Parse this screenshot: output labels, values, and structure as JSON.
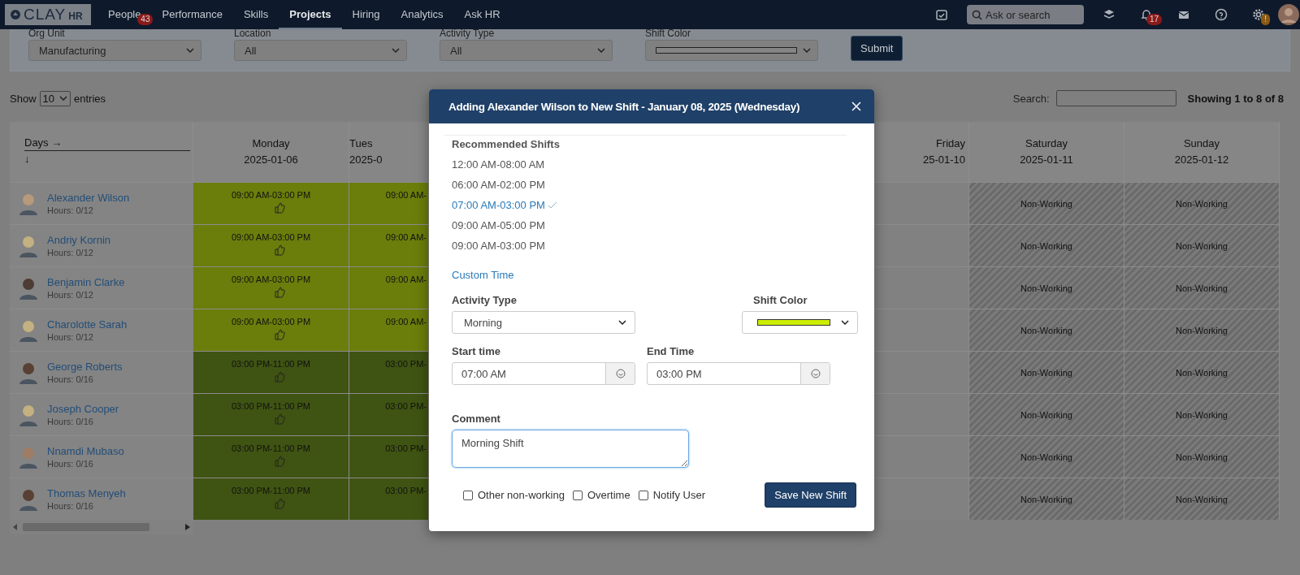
{
  "nav": {
    "logo": {
      "main": "CLAY",
      "sub": "HR"
    },
    "items": [
      {
        "label": "People",
        "selected": false,
        "badge": "43"
      },
      {
        "label": "Performance",
        "selected": false
      },
      {
        "label": "Skills",
        "selected": false
      },
      {
        "label": "Projects",
        "selected": true
      },
      {
        "label": "Hiring",
        "selected": false
      },
      {
        "label": "Analytics",
        "selected": false
      },
      {
        "label": "Ask HR",
        "selected": false
      }
    ],
    "search": {
      "placeholder": "Ask or search"
    },
    "notification_badge": "17",
    "settings_badge": "!"
  },
  "filters": [
    {
      "label": "Org Unit",
      "kind": "select",
      "value": "Manufacturing"
    },
    {
      "label": "Location",
      "kind": "select",
      "value": "All"
    },
    {
      "label": "Activity Type",
      "kind": "select",
      "value": "All"
    },
    {
      "label": "Shift Color",
      "kind": "color",
      "color": "#858585"
    }
  ],
  "submit": "Submit",
  "entries": {
    "show": "Show",
    "value": "10",
    "suffix": "entries"
  },
  "search": {
    "label": "Search:"
  },
  "info": "Showing 1 to 8 of 8",
  "table": {
    "corner": {
      "across": "Days →",
      "down": "↓"
    },
    "columns": [
      {
        "day": "Monday",
        "date": "2025-01-06"
      },
      {
        "day": "Tues",
        "date": "2025-0"
      },
      {
        "day": "Friday",
        "date": "25-01-10"
      },
      {
        "day": "Saturday",
        "date": "2025-01-11"
      },
      {
        "day": "Sunday",
        "date": "2025-01-12"
      }
    ],
    "rows": [
      {
        "name": "Alexander Wilson",
        "hours": "Hours: 0/12",
        "cells": [
          {
            "kind": "morning",
            "text": "09:00 AM-03:00 PM",
            "liked": true
          },
          {
            "kind": "morning",
            "text": "09:00 AM-"
          },
          {
            "kind": "empty"
          },
          {
            "kind": "off",
            "text": "Non-Working"
          },
          {
            "kind": "off",
            "text": "Non-Working"
          }
        ]
      },
      {
        "name": "Andriy Kornin",
        "hours": "Hours: 0/12",
        "cells": [
          {
            "kind": "morning",
            "text": "09:00 AM-03:00 PM",
            "liked": true
          },
          {
            "kind": "morning",
            "text": "09:00 AM-"
          },
          {
            "kind": "empty"
          },
          {
            "kind": "off",
            "text": "Non-Working"
          },
          {
            "kind": "off",
            "text": "Non-Working"
          }
        ]
      },
      {
        "name": "Benjamin Clarke",
        "hours": "Hours: 0/12",
        "cells": [
          {
            "kind": "morning",
            "text": "09:00 AM-03:00 PM",
            "liked": true
          },
          {
            "kind": "morning",
            "text": "09:00 AM-"
          },
          {
            "kind": "empty"
          },
          {
            "kind": "off",
            "text": "Non-Working"
          },
          {
            "kind": "off",
            "text": "Non-Working"
          }
        ]
      },
      {
        "name": "Charolotte Sarah",
        "hours": "Hours: 0/12",
        "cells": [
          {
            "kind": "morning",
            "text": "09:00 AM-03:00 PM",
            "liked": true
          },
          {
            "kind": "morning",
            "text": "09:00 AM-"
          },
          {
            "kind": "empty"
          },
          {
            "kind": "off",
            "text": "Non-Working"
          },
          {
            "kind": "off",
            "text": "Non-Working"
          }
        ]
      },
      {
        "name": "George Roberts",
        "hours": "Hours: 0/16",
        "cells": [
          {
            "kind": "evening",
            "text": "03:00 PM-11:00 PM",
            "liked": true
          },
          {
            "kind": "evening",
            "text": "03:00 PM-"
          },
          {
            "kind": "empty"
          },
          {
            "kind": "off",
            "text": "Non-Working"
          },
          {
            "kind": "off",
            "text": "Non-Working"
          }
        ]
      },
      {
        "name": "Joseph Cooper",
        "hours": "Hours: 0/16",
        "cells": [
          {
            "kind": "evening",
            "text": "03:00 PM-11:00 PM",
            "liked": true
          },
          {
            "kind": "evening",
            "text": "03:00 PM-"
          },
          {
            "kind": "empty"
          },
          {
            "kind": "off",
            "text": "Non-Working"
          },
          {
            "kind": "off",
            "text": "Non-Working"
          }
        ]
      },
      {
        "name": "Nnamdi Mubaso",
        "hours": "Hours: 0/16",
        "cells": [
          {
            "kind": "evening",
            "text": "03:00 PM-11:00 PM",
            "liked": true
          },
          {
            "kind": "evening",
            "text": "03:00 PM-"
          },
          {
            "kind": "empty"
          },
          {
            "kind": "off",
            "text": "Non-Working"
          },
          {
            "kind": "off",
            "text": "Non-Working"
          }
        ]
      },
      {
        "name": "Thomas Menyeh",
        "hours": "Hours: 0/16",
        "cells": [
          {
            "kind": "evening",
            "text": "03:00 PM-11:00 PM",
            "liked": true
          },
          {
            "kind": "evening",
            "text": "03:00 PM-"
          },
          {
            "kind": "empty"
          },
          {
            "kind": "off",
            "text": "Non-Working"
          },
          {
            "kind": "off",
            "text": "Non-Working"
          }
        ]
      }
    ]
  },
  "modal": {
    "title": "Adding Alexander Wilson to New Shift - January 08, 2025 (Wednesday)",
    "recommended_label": "Recommended Shifts",
    "shifts": [
      {
        "label": "12:00 AM-08:00 AM",
        "selected": false
      },
      {
        "label": "06:00 AM-02:00 PM",
        "selected": false
      },
      {
        "label": "07:00 AM-03:00 PM",
        "selected": true
      },
      {
        "label": "09:00 AM-05:00 PM",
        "selected": false
      },
      {
        "label": "09:00 AM-03:00 PM",
        "selected": false
      }
    ],
    "custom_time": "Custom Time",
    "activity": {
      "label": "Activity Type",
      "value": "Morning"
    },
    "shift_color": {
      "label": "Shift Color",
      "color": "#ccee00"
    },
    "start": {
      "label": "Start time",
      "value": "07:00 AM"
    },
    "end": {
      "label": "End Time",
      "value": "03:00 PM"
    },
    "comment": {
      "label": "Comment",
      "value": "Morning Shift"
    },
    "options": [
      {
        "label": "Other non-working",
        "checked": false
      },
      {
        "label": "Overtime",
        "checked": false
      },
      {
        "label": "Notify User",
        "checked": false
      }
    ],
    "save": "Save New Shift"
  }
}
